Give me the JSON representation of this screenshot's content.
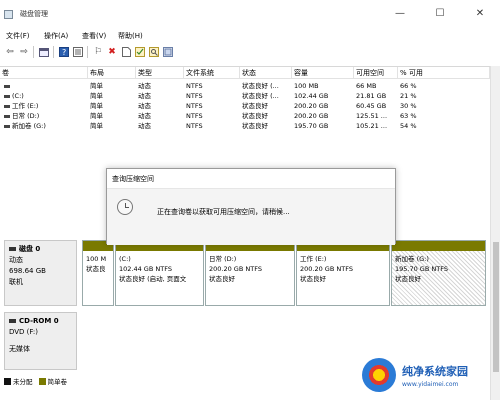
{
  "window": {
    "title": "磁盘管理",
    "min_glyph": "—",
    "max_glyph": "☐",
    "close_glyph": "✕"
  },
  "menu": [
    "文件(F)",
    "操作(A)",
    "查看(V)",
    "帮助(H)"
  ],
  "toolbar": {
    "icons": [
      "back-icon",
      "forward-icon",
      "console-icon",
      "help-icon",
      "properties-icon",
      "connect-icon",
      "delete-icon",
      "page-icon",
      "checked-icon",
      "search-icon",
      "settings-icon"
    ],
    "delete_color": "#d21f1f"
  },
  "table": {
    "headers": [
      "卷",
      "布局",
      "类型",
      "文件系统",
      "状态",
      "容量",
      "可用空间",
      "% 可用"
    ],
    "rows": [
      {
        "vol": "",
        "layout": "简单",
        "type": "动态",
        "fs": "NTFS",
        "status": "状态良好 (...",
        "cap": "100 MB",
        "free": "66 MB",
        "pct": "66 %"
      },
      {
        "vol": "(C:)",
        "layout": "简单",
        "type": "动态",
        "fs": "NTFS",
        "status": "状态良好 (...",
        "cap": "102.44 GB",
        "free": "21.81 GB",
        "pct": "21 %"
      },
      {
        "vol": "工作 (E:)",
        "layout": "简单",
        "type": "动态",
        "fs": "NTFS",
        "status": "状态良好",
        "cap": "200.20 GB",
        "free": "60.45 GB",
        "pct": "30 %"
      },
      {
        "vol": "日常 (D:)",
        "layout": "简单",
        "type": "动态",
        "fs": "NTFS",
        "status": "状态良好",
        "cap": "200.20 GB",
        "free": "125.51 ...",
        "pct": "63 %"
      },
      {
        "vol": "新加卷 (G:)",
        "layout": "简单",
        "type": "动态",
        "fs": "NTFS",
        "status": "状态良好",
        "cap": "195.70 GB",
        "free": "105.21 ...",
        "pct": "54 %"
      }
    ]
  },
  "disk0": {
    "name": "磁盘 0",
    "type": "动态",
    "size": "698.64 GB",
    "state": "联机",
    "partitions": [
      {
        "title": "",
        "line1": "100 M",
        "line2": "状态良"
      },
      {
        "title": "(C:)",
        "line1": "102.44 GB NTFS",
        "line2": "状态良好 (启动, 页面文"
      },
      {
        "title": "日常 (D:)",
        "line1": "200.20 GB NTFS",
        "line2": "状态良好"
      },
      {
        "title": "工作 (E:)",
        "line1": "200.20 GB NTFS",
        "line2": "状态良好"
      },
      {
        "title": "新加卷 (G:)",
        "line1": "195.70 GB NTFS",
        "line2": "状态良好"
      }
    ]
  },
  "cdrom0": {
    "name": "CD-ROM 0",
    "drive": "DVD (F:)",
    "media": "无媒体"
  },
  "legend": [
    {
      "label": "未分配",
      "color": "#111111"
    },
    {
      "label": "简单卷",
      "color": "#7a7a00"
    }
  ],
  "dialog": {
    "title": "查询压缩空间",
    "message": "正在查询卷以获取可用压缩空间，请稍候..."
  },
  "watermark": {
    "main": "纯净系统家园",
    "sub": "www.yidaimei.com"
  },
  "colors": {
    "volume_bar": "#7a7a00",
    "accent_blue": "#1f5fb6"
  }
}
